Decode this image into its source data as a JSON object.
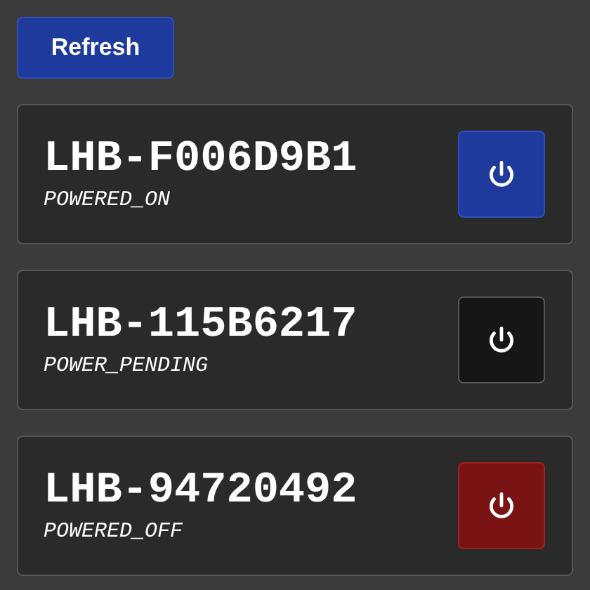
{
  "refresh_button": "Refresh",
  "devices": [
    {
      "name": "LHB-F006D9B1",
      "status": "POWERED_ON",
      "kind": "on"
    },
    {
      "name": "LHB-115B6217",
      "status": "POWER_PENDING",
      "kind": "pending"
    },
    {
      "name": "LHB-94720492",
      "status": "POWERED_OFF",
      "kind": "off"
    }
  ]
}
